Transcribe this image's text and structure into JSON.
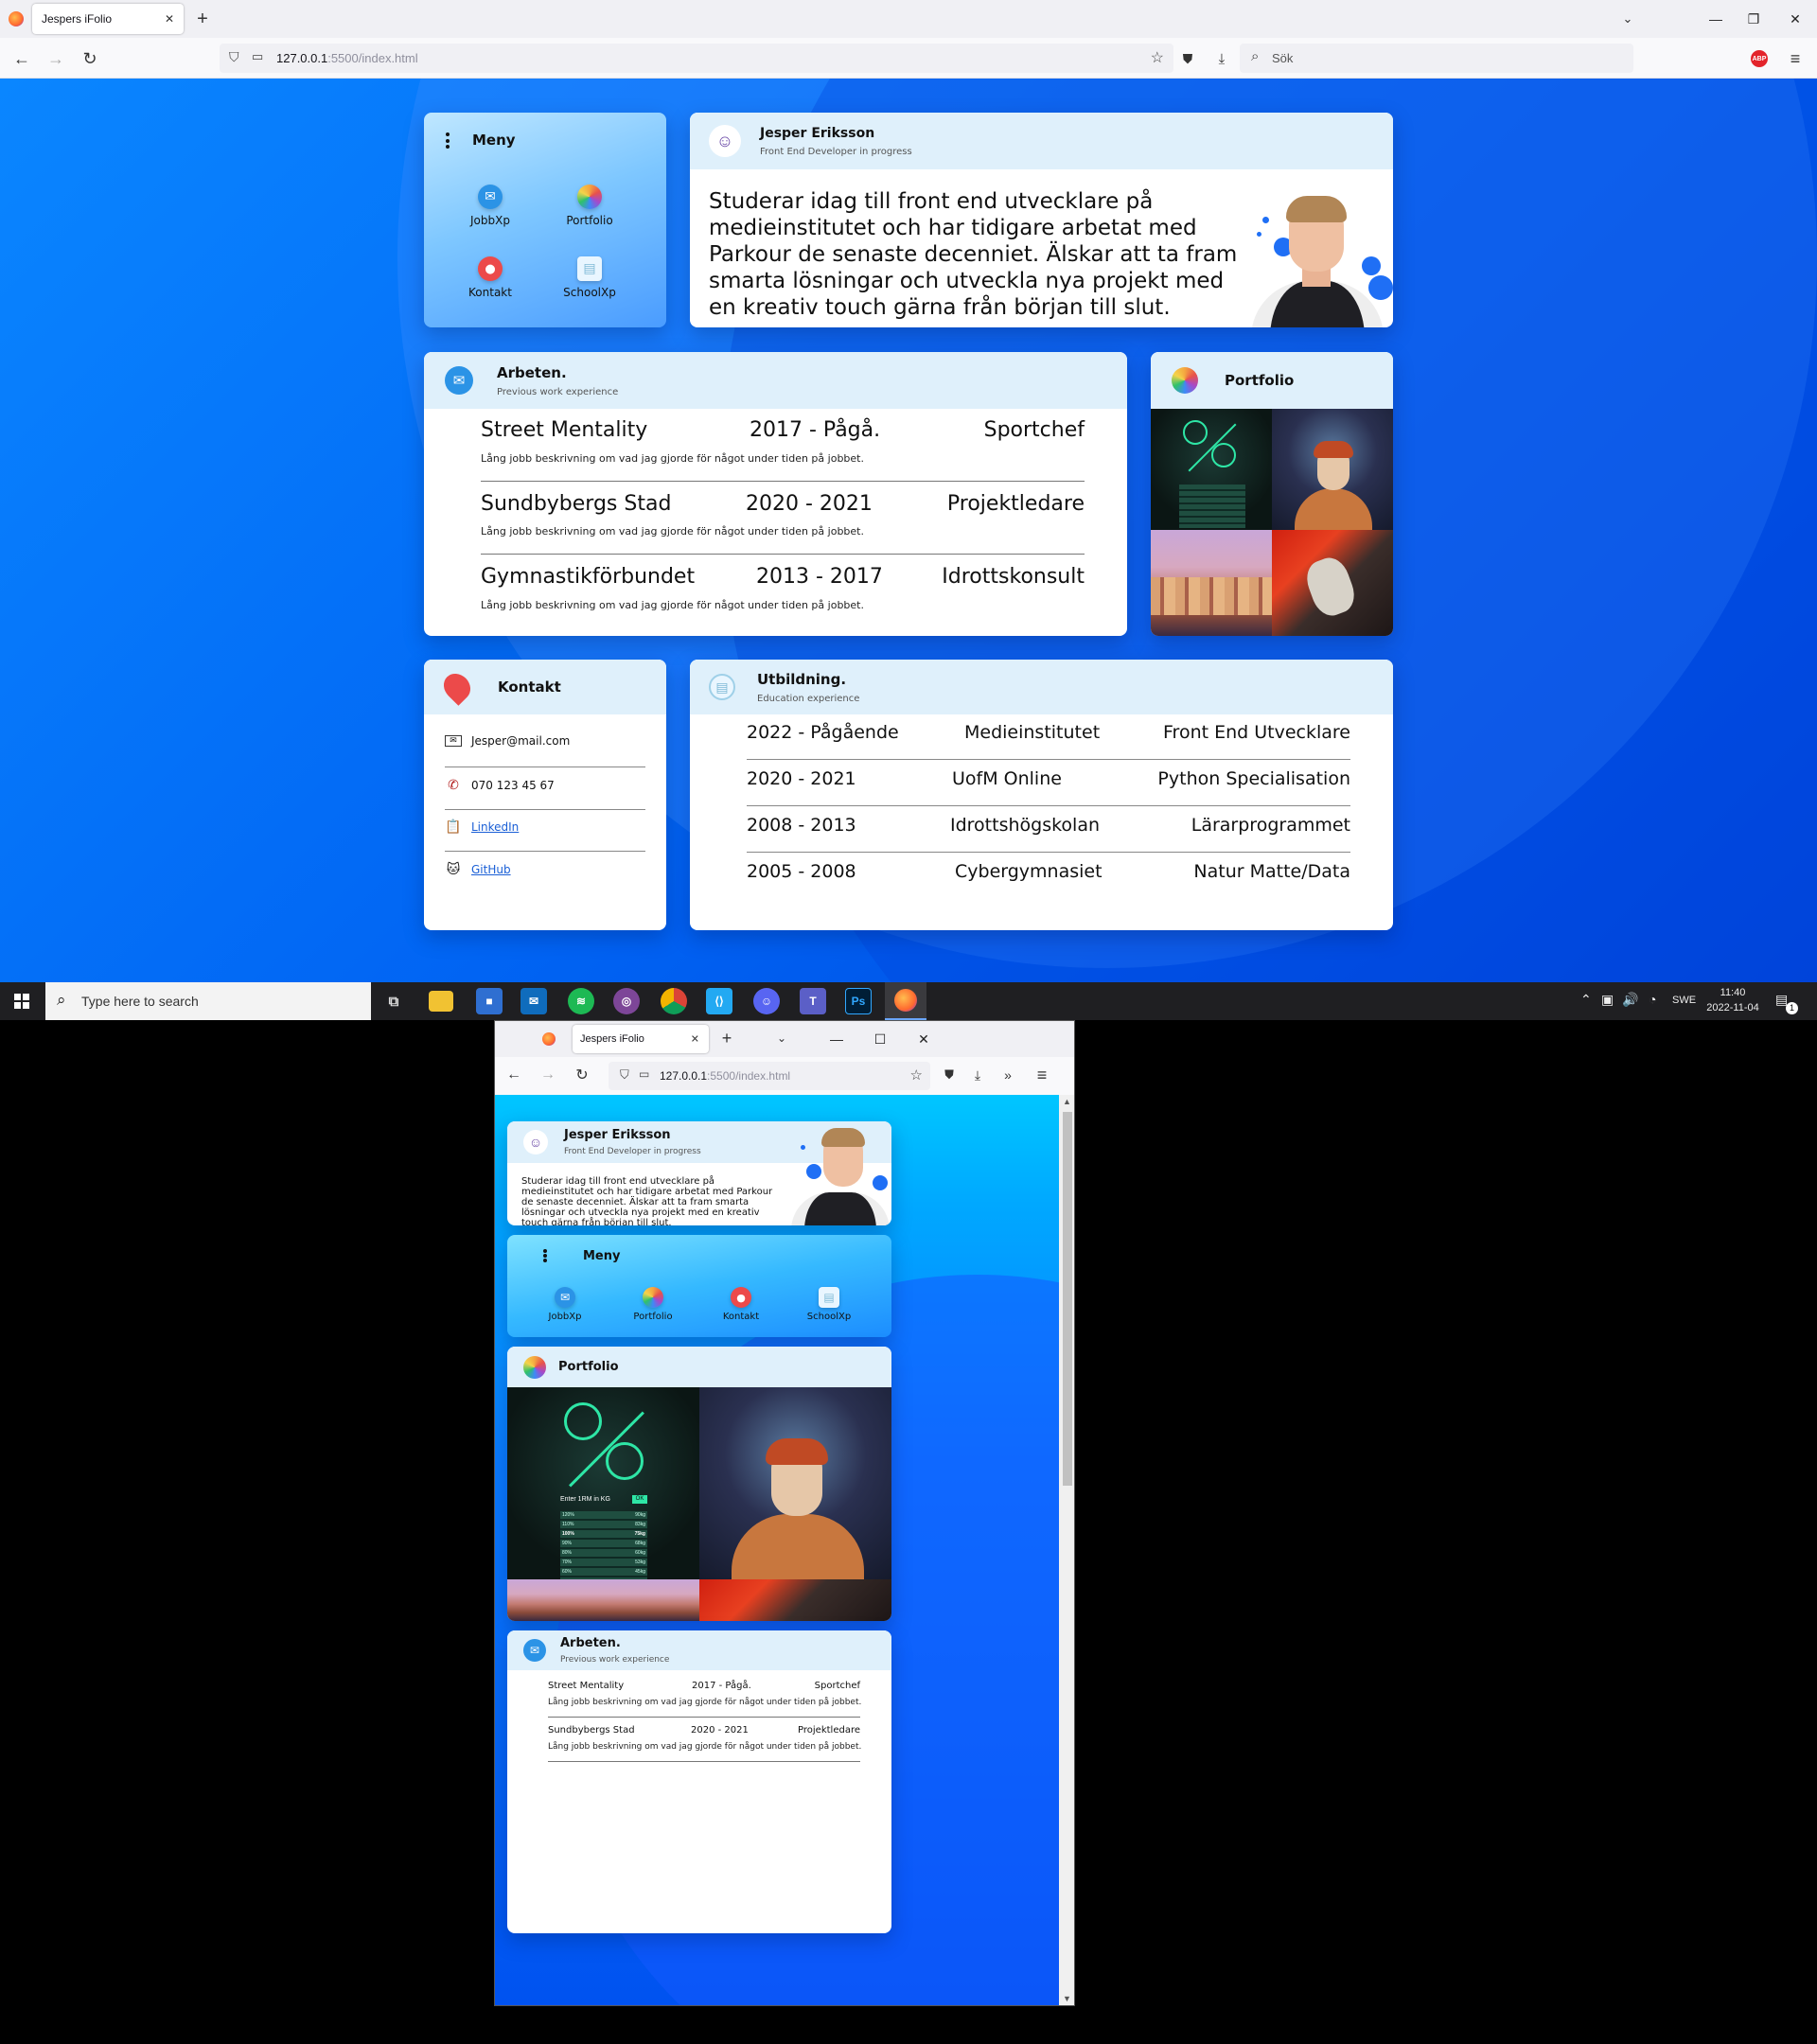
{
  "browser": {
    "tab_title": "Jespers iFolio",
    "url_host": "127.0.0.1",
    "url_path": ":5500/index.html",
    "search_placeholder": "Sök",
    "new_tab": "+",
    "close_tab": "✕"
  },
  "menu": {
    "title": "Meny",
    "items": [
      {
        "label": "JobbXp",
        "icon": "mail-icon",
        "color": "#2b93e6"
      },
      {
        "label": "Portfolio",
        "icon": "photos-icon",
        "color": "#f4a640"
      },
      {
        "label": "Kontakt",
        "icon": "location-pin-icon",
        "color": "#ec4a4a"
      },
      {
        "label": "SchoolXp",
        "icon": "notebook-icon",
        "color": "#cde7f5"
      }
    ]
  },
  "profile": {
    "name": "Jesper Eriksson",
    "subtitle": "Front End Developer in progress",
    "bio": "Studerar idag till front end utvecklare på medieinstitutet och har tidigare arbetat med Parkour de senaste decenniet. Älskar att ta fram smarta lösningar och utveckla nya projekt med en kreativ touch gärna från början till slut."
  },
  "work": {
    "title": "Arbeten.",
    "subtitle": "Previous work experience",
    "jobs": [
      {
        "company": "Street Mentality",
        "period": "2017 - Pågå.",
        "role": "Sportchef",
        "desc": "Lång jobb beskrivning om vad jag gjorde för något under tiden på jobbet."
      },
      {
        "company": "Sundbybergs Stad",
        "period": "2020 - 2021",
        "role": "Projektledare",
        "desc": "Lång jobb beskrivning om vad jag gjorde för något under tiden på jobbet."
      },
      {
        "company": "Gymnastikförbundet",
        "period": "2013 - 2017",
        "role": "Idrottskonsult",
        "desc": "Lång jobb beskrivning om vad jag gjorde för något under tiden på jobbet."
      }
    ]
  },
  "portfolio": {
    "title": "Portfolio",
    "app_label": "Enter 1RM in KG",
    "app_ok": "OK",
    "app_table": [
      [
        "120%",
        "90kg"
      ],
      [
        "110%",
        "83kg"
      ],
      [
        "100%",
        "75kg"
      ],
      [
        "90%",
        "68kg"
      ],
      [
        "80%",
        "60kg"
      ],
      [
        "70%",
        "53kg"
      ],
      [
        "60%",
        "45kg"
      ]
    ]
  },
  "contact": {
    "title": "Kontakt",
    "email": "Jesper@mail.com",
    "phone": "070 123 45 67",
    "linkedin": "LinkedIn",
    "github": "GitHub"
  },
  "education": {
    "title": "Utbildning.",
    "subtitle": "Education experience",
    "rows": [
      {
        "period": "2022 - Pågående",
        "school": "Medieinstitutet",
        "program": "Front End Utvecklare"
      },
      {
        "period": "2020 - 2021",
        "school": "UofM Online",
        "program": "Python Specialisation"
      },
      {
        "period": "2008 - 2013",
        "school": "Idrottshögskolan",
        "program": "Lärarprogrammet"
      },
      {
        "period": "2005 - 2008",
        "school": "Cybergymnasiet",
        "program": "Natur Matte/Data"
      }
    ]
  },
  "taskbar": {
    "search_placeholder": "Type here to search",
    "language": "SWE",
    "time": "11:40",
    "date": "2022-11-04",
    "notifications": "1",
    "apps": [
      "task-view-icon",
      "file-explorer-icon",
      "store-icon",
      "mail-app-icon",
      "spotify-icon",
      "tor-icon",
      "chrome-icon",
      "vscode-icon",
      "discord-icon",
      "teams-icon",
      "photoshop-icon",
      "firefox-icon"
    ]
  },
  "colors": {
    "accent": "#0a6cff",
    "header": "#dff0fb"
  }
}
